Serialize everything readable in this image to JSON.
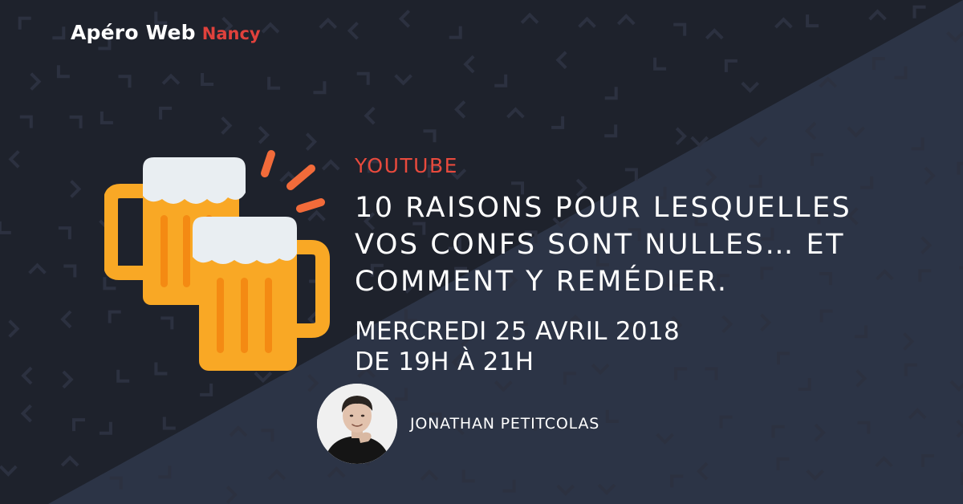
{
  "brand": {
    "name": "Apéro Web",
    "city": "Nancy"
  },
  "event": {
    "category": "YOUTUBE",
    "title_lines": [
      "10 RAISONS POUR LESQUELLES",
      "VOS CONFS SONT NULLES… ET",
      "COMMENT Y REMÉDIER."
    ],
    "date_lines": [
      "MERCREDI 25 AVRIL 2018",
      "DE 19H À 21H"
    ]
  },
  "speaker": {
    "name": "JONATHAN PETITCOLAS"
  },
  "illustration": {
    "icon": "beer-mugs-cheers-icon"
  },
  "colors": {
    "background_dark": "#1e222c",
    "background_light": "#2c3446",
    "accent": "#e84a3d",
    "beer": "#f9a825",
    "foam": "#e9eef2"
  }
}
